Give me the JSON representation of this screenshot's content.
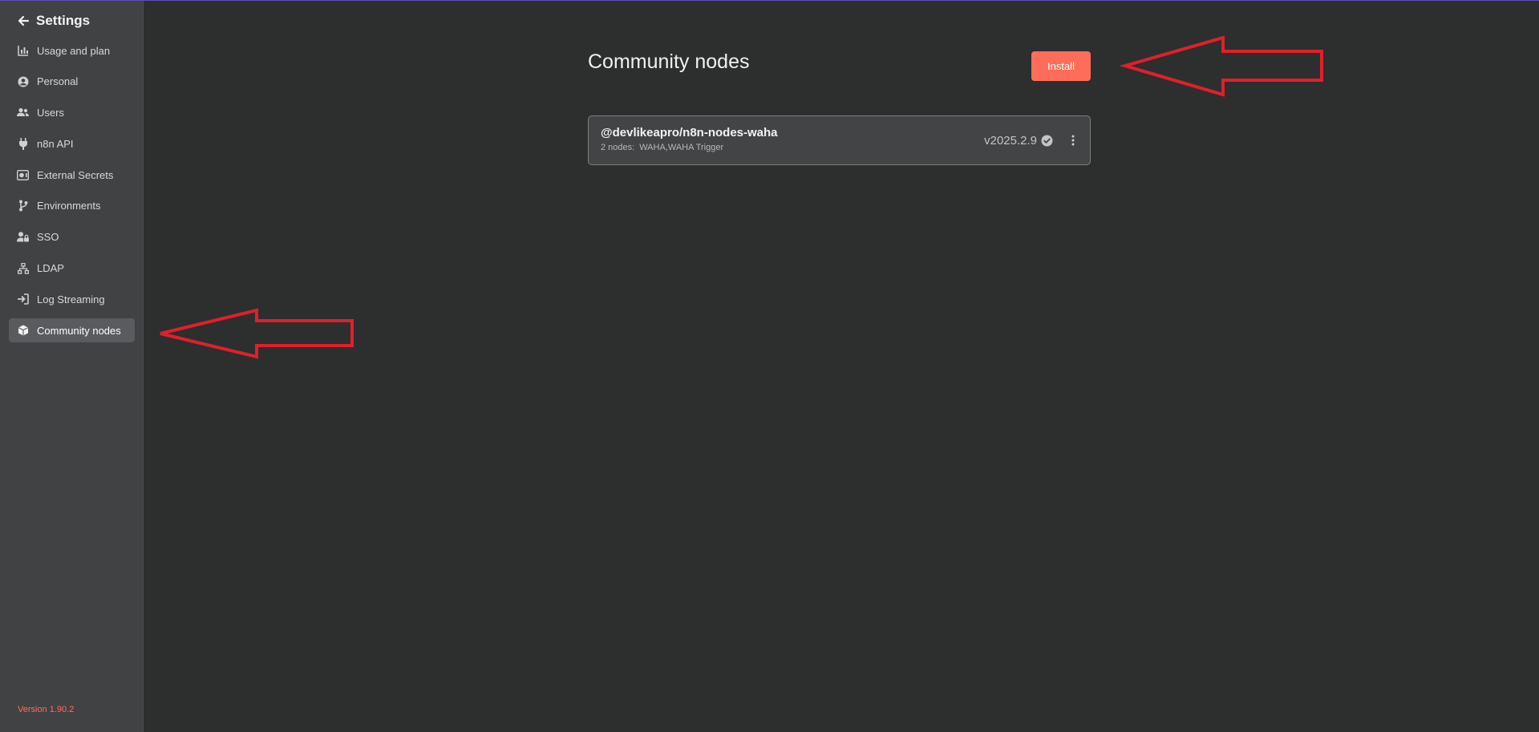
{
  "sidebar": {
    "title": "Settings",
    "items": [
      {
        "label": "Usage and plan",
        "icon": "chart-icon"
      },
      {
        "label": "Personal",
        "icon": "user-circle-icon"
      },
      {
        "label": "Users",
        "icon": "users-icon"
      },
      {
        "label": "n8n API",
        "icon": "plug-icon"
      },
      {
        "label": "External Secrets",
        "icon": "vault-icon"
      },
      {
        "label": "Environments",
        "icon": "branch-icon"
      },
      {
        "label": "SSO",
        "icon": "user-lock-icon"
      },
      {
        "label": "LDAP",
        "icon": "network-icon"
      },
      {
        "label": "Log Streaming",
        "icon": "sign-in-icon"
      },
      {
        "label": "Community nodes",
        "icon": "cube-icon",
        "active": true
      }
    ],
    "version": "Version 1.90.2"
  },
  "main": {
    "title": "Community nodes",
    "install_label": "Install",
    "package": {
      "name": "@devlikeapro/n8n-nodes-waha",
      "nodes_count": "2 nodes:",
      "nodes_list": "WAHA,WAHA Trigger",
      "version": "v2025.2.9"
    }
  },
  "colors": {
    "accent": "#ff6d5a",
    "annotation": "#e0202a",
    "background": "#2d2e2e",
    "sidebar": "#414244"
  }
}
